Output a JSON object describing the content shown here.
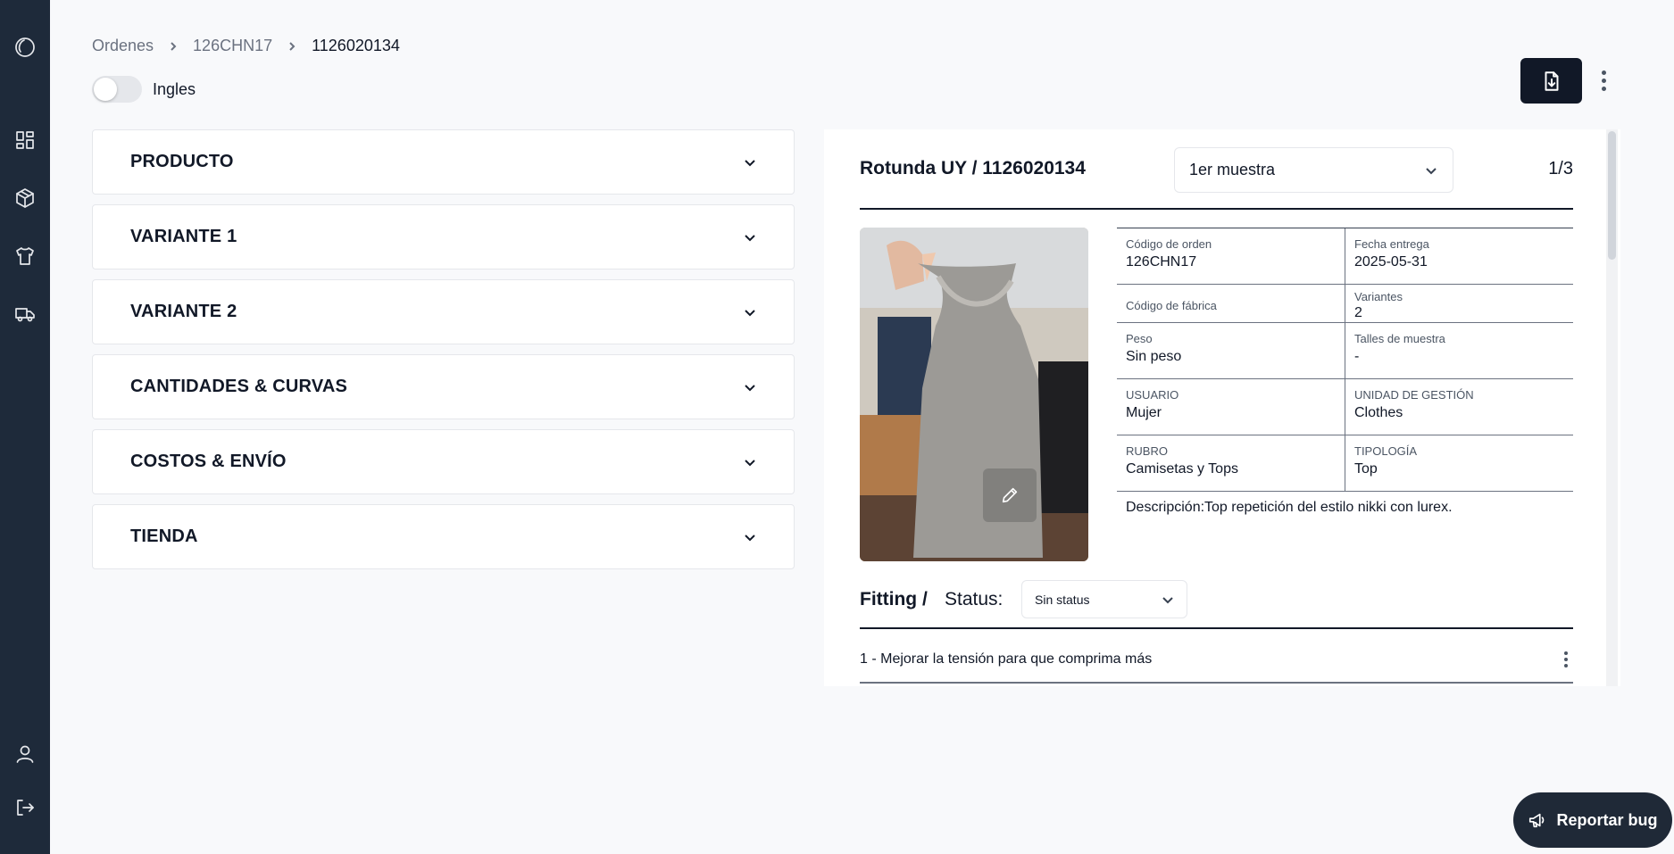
{
  "sidebar": {
    "icons": [
      "logo-icon",
      "dashboard-icon",
      "boxes-icon",
      "shirt-icon",
      "truck-icon",
      "user-icon",
      "logout-icon"
    ]
  },
  "breadcrumb": {
    "items": [
      "Ordenes",
      "126CHN17",
      "1126020134"
    ]
  },
  "toggle": {
    "label": "Ingles",
    "on": false
  },
  "accordion": {
    "sections": [
      "PRODUCTO",
      "VARIANTE 1",
      "VARIANTE 2",
      "CANTIDADES & CURVAS",
      "COSTOS & ENVÍO",
      "TIENDA"
    ]
  },
  "panel": {
    "title": "Rotunda UY / 1126020134",
    "sample_select": "1er muestra",
    "pager": "1/3",
    "info": {
      "order_code_label": "Código de orden",
      "order_code": "126CHN17",
      "delivery_date_label": "Fecha entrega",
      "delivery_date": "2025-05-31",
      "factory_code_label": "Código de fábrica",
      "variants_label": "Variantes",
      "variants": "2",
      "weight_label": "Peso",
      "weight": "Sin peso",
      "sample_sizes_label": "Talles de muestra",
      "sample_sizes": "-",
      "user_label": "USUARIO",
      "user": "Mujer",
      "unit_label": "UNIDAD DE GESTIÓN",
      "unit": "Clothes",
      "category_label": "RUBRO",
      "category": "Camisetas y Tops",
      "typology_label": "TIPOLOGÍA",
      "typology": "Top"
    },
    "description": "Descripción:Top repetición del estilo nikki con lurex.",
    "fitting": {
      "title": "Fitting /",
      "status_label": "Status:",
      "status_value": "Sin status",
      "items": [
        "1 - Mejorar la tensión para que comprima más"
      ]
    }
  },
  "report_bug": {
    "label": "Reportar bug"
  },
  "colors": {
    "sidebar": "#1e2a3a",
    "primary_button": "#111827",
    "background": "#f8f9fb"
  }
}
